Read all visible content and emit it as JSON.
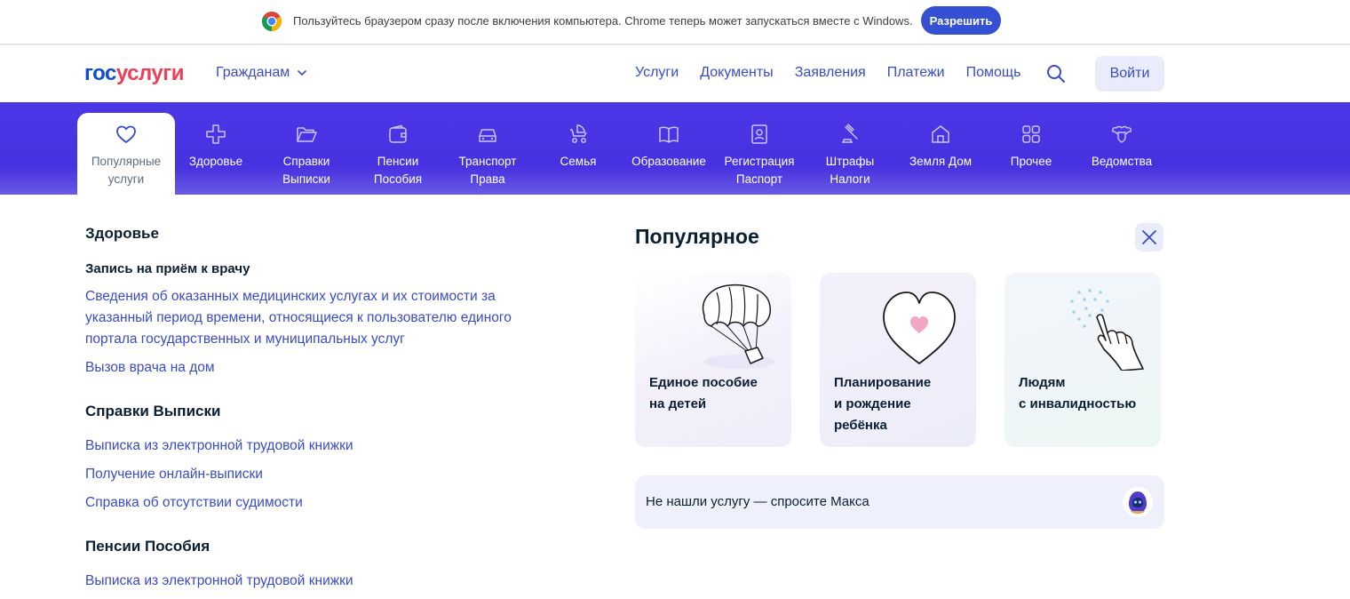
{
  "infobar": {
    "text": "Пользуйтесь браузером сразу после включения компьютера. Chrome теперь может запускаться вместе с Windows.",
    "allow_label": "Разрешить"
  },
  "header": {
    "logo_part1": "гос",
    "logo_part2": "услуги",
    "audience": "Гражданам",
    "nav": [
      "Услуги",
      "Документы",
      "Заявления",
      "Платежи",
      "Помощь"
    ],
    "login_label": "Войти"
  },
  "categories": [
    {
      "label": "Популярные\nуслуги",
      "icon": "heart-icon"
    },
    {
      "label": "Здоровье",
      "icon": "medical-cross-icon"
    },
    {
      "label": "Справки\nВыписки",
      "icon": "folder-icon"
    },
    {
      "label": "Пенсии\nПособия",
      "icon": "wallet-icon"
    },
    {
      "label": "Транспорт\nПрава",
      "icon": "car-icon"
    },
    {
      "label": "Семья",
      "icon": "stroller-icon"
    },
    {
      "label": "Образование",
      "icon": "book-icon"
    },
    {
      "label": "Регистрация\nПаспорт",
      "icon": "passport-icon"
    },
    {
      "label": "Штрафы\nНалоги",
      "icon": "gavel-icon"
    },
    {
      "label": "Земля Дом",
      "icon": "house-icon"
    },
    {
      "label": "Прочее",
      "icon": "grid-icon"
    },
    {
      "label": "Ведомства",
      "icon": "emblem-icon"
    }
  ],
  "sections": {
    "health": {
      "title": "Здоровье",
      "items": [
        "Запись на приём к врачу",
        "Сведения об оказанных медицинских услугах и их стоимости за указанный период времени, относящиеся к пользователю единого портала государственных и муниципальных услуг",
        "Вызов врача на дом"
      ]
    },
    "certificates": {
      "title": "Справки Выписки",
      "items": [
        "Выписка из электронной трудовой книжки",
        "Получение онлайн-выписки",
        "Справка об отсутствии судимости"
      ]
    },
    "pensions": {
      "title": "Пенсии Пособия",
      "items": [
        "Выписка из электронной трудовой книжки"
      ]
    }
  },
  "popular": {
    "title": "Популярное",
    "cards": [
      {
        "label": "Единое пособие\nна детей",
        "icon": "parachute-gift-icon"
      },
      {
        "label": "Планирование\nи рождение\nребёнка",
        "icon": "heart-illustration-icon"
      },
      {
        "label": "Людям\nс инвалидностью",
        "icon": "hand-braille-icon"
      }
    ],
    "ask_text": "Не нашли услугу — спросите Макса"
  },
  "colors": {
    "brand_blue": "#0d4cd3",
    "brand_red": "#ee3f58",
    "link": "#3a4bc9",
    "category_bar": "#4b37e6",
    "allow_button": "#3550d3"
  }
}
